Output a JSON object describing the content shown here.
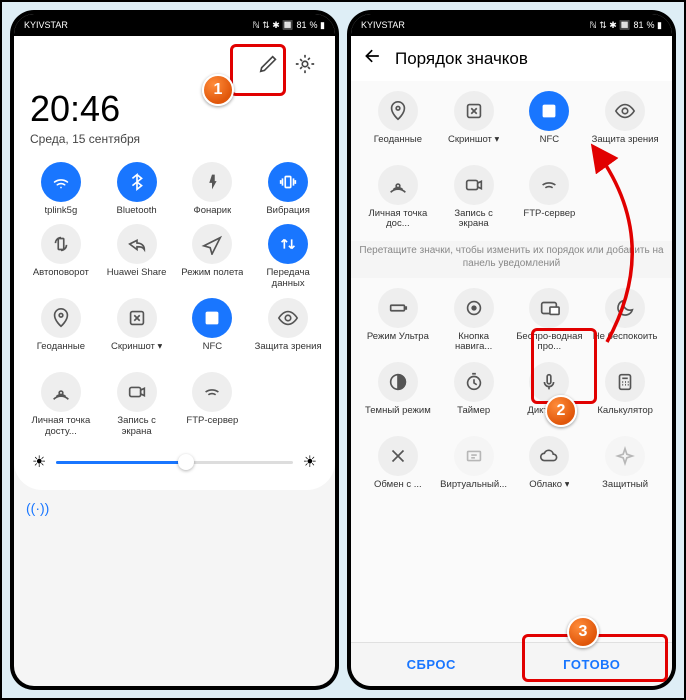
{
  "statusbar": {
    "carrier": "KYIVSTAR",
    "battery": "81",
    "icons": "ℕ ⏧ ⁞ 🔲"
  },
  "left": {
    "clock": "20:46",
    "date": "Среда, 15 сентября",
    "tiles": [
      {
        "name": "wifi",
        "on": true,
        "label": "tplink5g",
        "glyph": "wifi"
      },
      {
        "name": "bluetooth",
        "on": true,
        "label": "Bluetooth",
        "glyph": "bt"
      },
      {
        "name": "flashlight",
        "on": false,
        "label": "Фонарик",
        "glyph": "flash"
      },
      {
        "name": "vibration",
        "on": true,
        "label": "Вибрация",
        "glyph": "vib"
      },
      {
        "name": "autorotate",
        "on": false,
        "label": "Автоповорот",
        "glyph": "rotate"
      },
      {
        "name": "huawei-share",
        "on": false,
        "label": "Huawei Share",
        "glyph": "share"
      },
      {
        "name": "airplane",
        "on": false,
        "label": "Режим полета",
        "glyph": "plane",
        "two": true
      },
      {
        "name": "data",
        "on": true,
        "label": "Передача данных",
        "glyph": "data",
        "two": true
      },
      {
        "name": "location",
        "on": false,
        "label": "Геоданные",
        "glyph": "loc"
      },
      {
        "name": "screenshot",
        "on": false,
        "label": "Скриншот ▾",
        "glyph": "shot"
      },
      {
        "name": "nfc",
        "on": true,
        "label": "NFC",
        "glyph": "nfc"
      },
      {
        "name": "eye-comfort",
        "on": false,
        "label": "Защита зрения",
        "glyph": "eye",
        "two": true
      },
      {
        "name": "hotspot",
        "on": false,
        "label": "Личная точка досту...",
        "glyph": "hotspot",
        "two": true
      },
      {
        "name": "screen-record",
        "on": false,
        "label": "Запись с экрана",
        "glyph": "rec",
        "two": true
      },
      {
        "name": "ftp",
        "on": false,
        "label": "FTP-сервер",
        "glyph": "wifi2"
      }
    ]
  },
  "right": {
    "title": "Порядок значков",
    "hint": "Перетащите значки, чтобы изменить их порядок или добавить на панель уведомлений",
    "g1": [
      {
        "name": "location",
        "label": "Геоданные",
        "glyph": "loc"
      },
      {
        "name": "screenshot",
        "label": "Скриншот ▾",
        "glyph": "shot"
      },
      {
        "name": "nfc",
        "label": "NFC",
        "glyph": "nfc",
        "on": true
      },
      {
        "name": "eye-comfort",
        "label": "Защита зрения",
        "glyph": "eye",
        "two": true
      },
      {
        "name": "hotspot",
        "label": "Личная точка дос...",
        "glyph": "hotspot",
        "two": true
      },
      {
        "name": "screen-record",
        "label": "Запись с экрана",
        "glyph": "rec",
        "two": true
      },
      {
        "name": "ftp",
        "label": "FTP-сервер",
        "glyph": "wifi2"
      }
    ],
    "g2": [
      {
        "name": "ultra-mode",
        "label": "Режим Ультра",
        "glyph": "battery",
        "two": true
      },
      {
        "name": "nav-button",
        "label": "Кнопка навига...",
        "glyph": "navbtn",
        "two": true
      },
      {
        "name": "wireless-proj",
        "label": "Беспро-водная про...",
        "glyph": "cast",
        "two": true
      },
      {
        "name": "dnd",
        "label": "Не беспокоить",
        "glyph": "moon",
        "two": true
      },
      {
        "name": "dark-mode",
        "label": "Темный режим",
        "glyph": "dark",
        "two": true
      },
      {
        "name": "timer",
        "label": "Таймер",
        "glyph": "timer"
      },
      {
        "name": "recorder",
        "label": "Диктофон",
        "glyph": "mic"
      },
      {
        "name": "calculator",
        "label": "Калькулятор",
        "glyph": "calc"
      },
      {
        "name": "share",
        "label": "Обмен с ...",
        "glyph": "xshare"
      },
      {
        "name": "virtual",
        "label": "Виртуальный...",
        "glyph": "virt",
        "dim": true
      },
      {
        "name": "cloud",
        "label": "Облако ▾",
        "glyph": "cloud"
      },
      {
        "name": "filter",
        "label": "Защитный",
        "glyph": "sparkle",
        "dim": true
      }
    ],
    "reset": "СБРОС",
    "done": "ГОТОВО"
  }
}
